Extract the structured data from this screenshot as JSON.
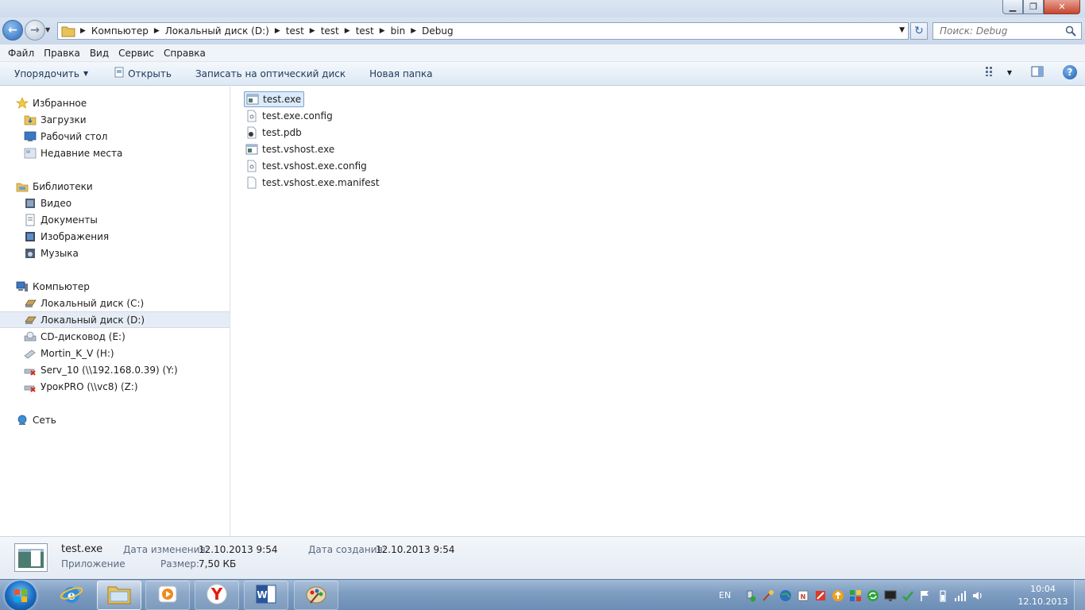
{
  "window": {
    "minimize_glyph": "▁",
    "maximize_glyph": "❐",
    "close_glyph": "✕"
  },
  "address": {
    "breadcrumbs": [
      "Компьютер",
      "Локальный диск (D:)",
      "test",
      "test",
      "test",
      "bin",
      "Debug"
    ],
    "search_placeholder": "Поиск: Debug"
  },
  "menu": {
    "items": [
      "Файл",
      "Правка",
      "Вид",
      "Сервис",
      "Справка"
    ]
  },
  "commands": {
    "organize": "Упорядочить",
    "open": "Открыть",
    "burn": "Записать на оптический диск",
    "new_folder": "Новая папка"
  },
  "nav": {
    "favorites": {
      "label": "Избранное",
      "items": [
        "Загрузки",
        "Рабочий стол",
        "Недавние места"
      ]
    },
    "libraries": {
      "label": "Библиотеки",
      "items": [
        "Видео",
        "Документы",
        "Изображения",
        "Музыка"
      ]
    },
    "computer": {
      "label": "Компьютер",
      "items": [
        "Локальный диск (C:)",
        "Локальный диск (D:)",
        "CD-дисковод (E:)",
        "Mortin_K_V (H:)",
        "Serv_10 (\\\\192.168.0.39) (Y:)",
        "УрокPRO (\\\\vc8) (Z:)"
      ]
    },
    "network": {
      "label": "Сеть"
    }
  },
  "files": [
    {
      "name": "test.exe",
      "type": "exe",
      "selected": true
    },
    {
      "name": "test.exe.config",
      "type": "config",
      "selected": false
    },
    {
      "name": "test.pdb",
      "type": "pdb",
      "selected": false
    },
    {
      "name": "test.vshost.exe",
      "type": "exe",
      "selected": false
    },
    {
      "name": "test.vshost.exe.config",
      "type": "config",
      "selected": false
    },
    {
      "name": "test.vshost.exe.manifest",
      "type": "blank",
      "selected": false
    }
  ],
  "details": {
    "name": "test.exe",
    "kind": "Приложение",
    "modified_label": "Дата изменения:",
    "modified_value": "12.10.2013 9:54",
    "size_label": "Размер:",
    "size_value": "7,50 КБ",
    "created_label": "Дата создания:",
    "created_value": "12.10.2013 9:54"
  },
  "taskbar": {
    "apps": [
      "internet-explorer",
      "windows-explorer",
      "media-player",
      "yandex-browser",
      "microsoft-word",
      "paint-app"
    ],
    "language": "EN",
    "time": "10:04",
    "date": "12.10.2013"
  },
  "colors": {
    "selection": "#dcebfc",
    "taskbar": "#7d9cc0",
    "accent": "#2b68b8"
  }
}
